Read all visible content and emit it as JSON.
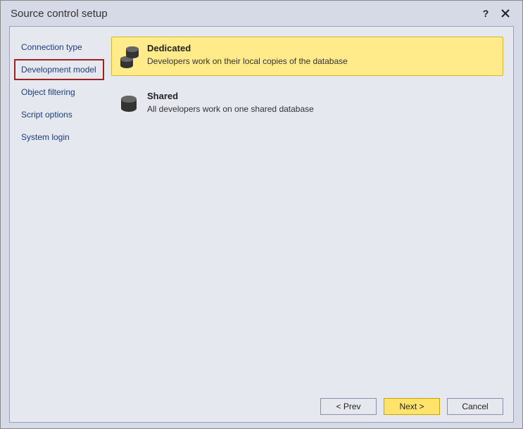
{
  "window": {
    "title": "Source control setup"
  },
  "sidebar": {
    "items": [
      {
        "label": "Connection type"
      },
      {
        "label": "Development model"
      },
      {
        "label": "Object filtering"
      },
      {
        "label": "Script options"
      },
      {
        "label": "System login"
      }
    ]
  },
  "options": [
    {
      "title": "Dedicated",
      "desc": "Developers work on their local copies of the database"
    },
    {
      "title": "Shared",
      "desc": "All developers work on one shared database"
    }
  ],
  "footer": {
    "prev": "< Prev",
    "next": "Next >",
    "cancel": "Cancel"
  }
}
